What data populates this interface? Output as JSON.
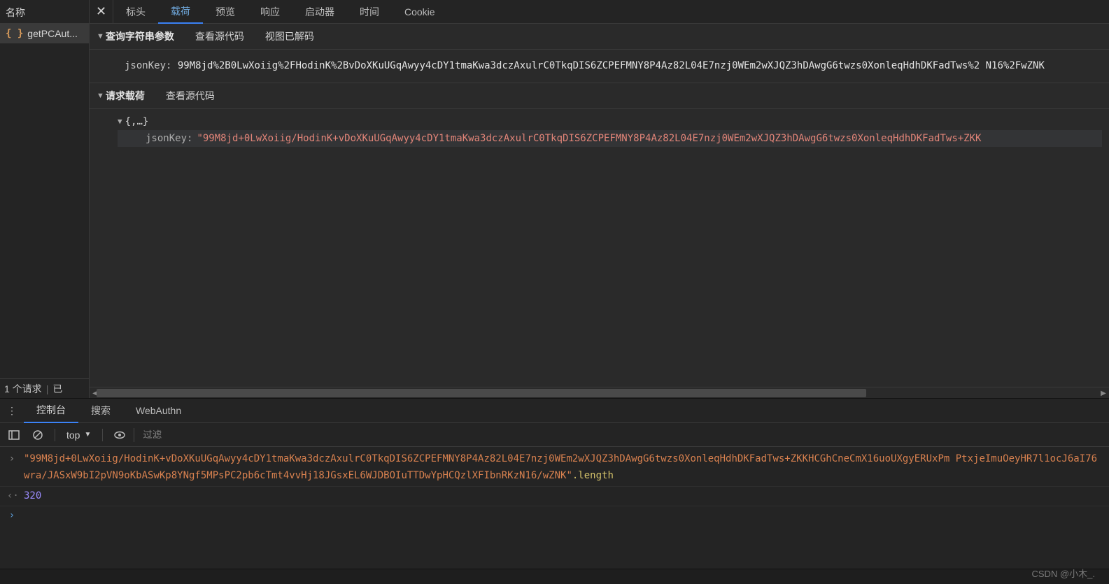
{
  "sidebar": {
    "header": "名称",
    "items": [
      "getPCAut..."
    ],
    "footer_requests": "1 个请求",
    "footer_status": "已"
  },
  "tabs": {
    "headers": "标头",
    "payload": "载荷",
    "preview": "预览",
    "response": "响应",
    "initiator": "启动器",
    "timing": "时间",
    "cookies": "Cookie"
  },
  "query_section": {
    "title": "查询字符串参数",
    "view_source": "查看源代码",
    "view_decoded": "视图已解码",
    "key": "jsonKey:",
    "value": "99M8jd%2B0LwXoiig%2FHodinK%2BvDoXKuUGqAwyy4cDY1tmaKwa3dczAxulrC0TkqDIS6ZCPEFMNY8P4Az82L04E7nzj0WEm2wXJQZ3hDAwgG6twzs0XonleqHdhDKFadTws%2 N16%2FwZNK"
  },
  "payload_section": {
    "title": "请求载荷",
    "view_source": "查看源代码",
    "tree_root": "{,…}",
    "tree_key": "jsonKey:",
    "tree_value": "\"99M8jd+0LwXoiig/HodinK+vDoXKuUGqAwyy4cDY1tmaKwa3dczAxulrC0TkqDIS6ZCPEFMNY8P4Az82L04E7nzj0WEm2wXJQZ3hDAwgG6twzs0XonleqHdhDKFadTws+ZKK"
  },
  "drawer": {
    "console": "控制台",
    "search": "搜索",
    "webauthn": "WebAuthn"
  },
  "console_toolbar": {
    "context": "top",
    "filter_placeholder": "过滤"
  },
  "console": {
    "input_string": "\"99M8jd+0LwXoiig/HodinK+vDoXKuUGqAwyy4cDY1tmaKwa3dczAxulrC0TkqDIS6ZCPEFMNY8P4Az82L04E7nzj0WEm2wXJQZ3hDAwgG6twzs0XonleqHdhDKFadTws+ZKKHCGhCneCmX16uoUXgyERUxPm PtxjeImuOeyHR7l1ocJ6aI76wra/JASxW9bI2pVN9oKbASwKp8YNgf5MPsPC2pb6cTmt4vvHj18JGsxEL6WJDBOIuTTDwYpHCQzlXFIbnRKzN16/wZNK\"",
    "input_prop": ".length",
    "output": "320"
  },
  "watermark": "CSDN @小木_."
}
